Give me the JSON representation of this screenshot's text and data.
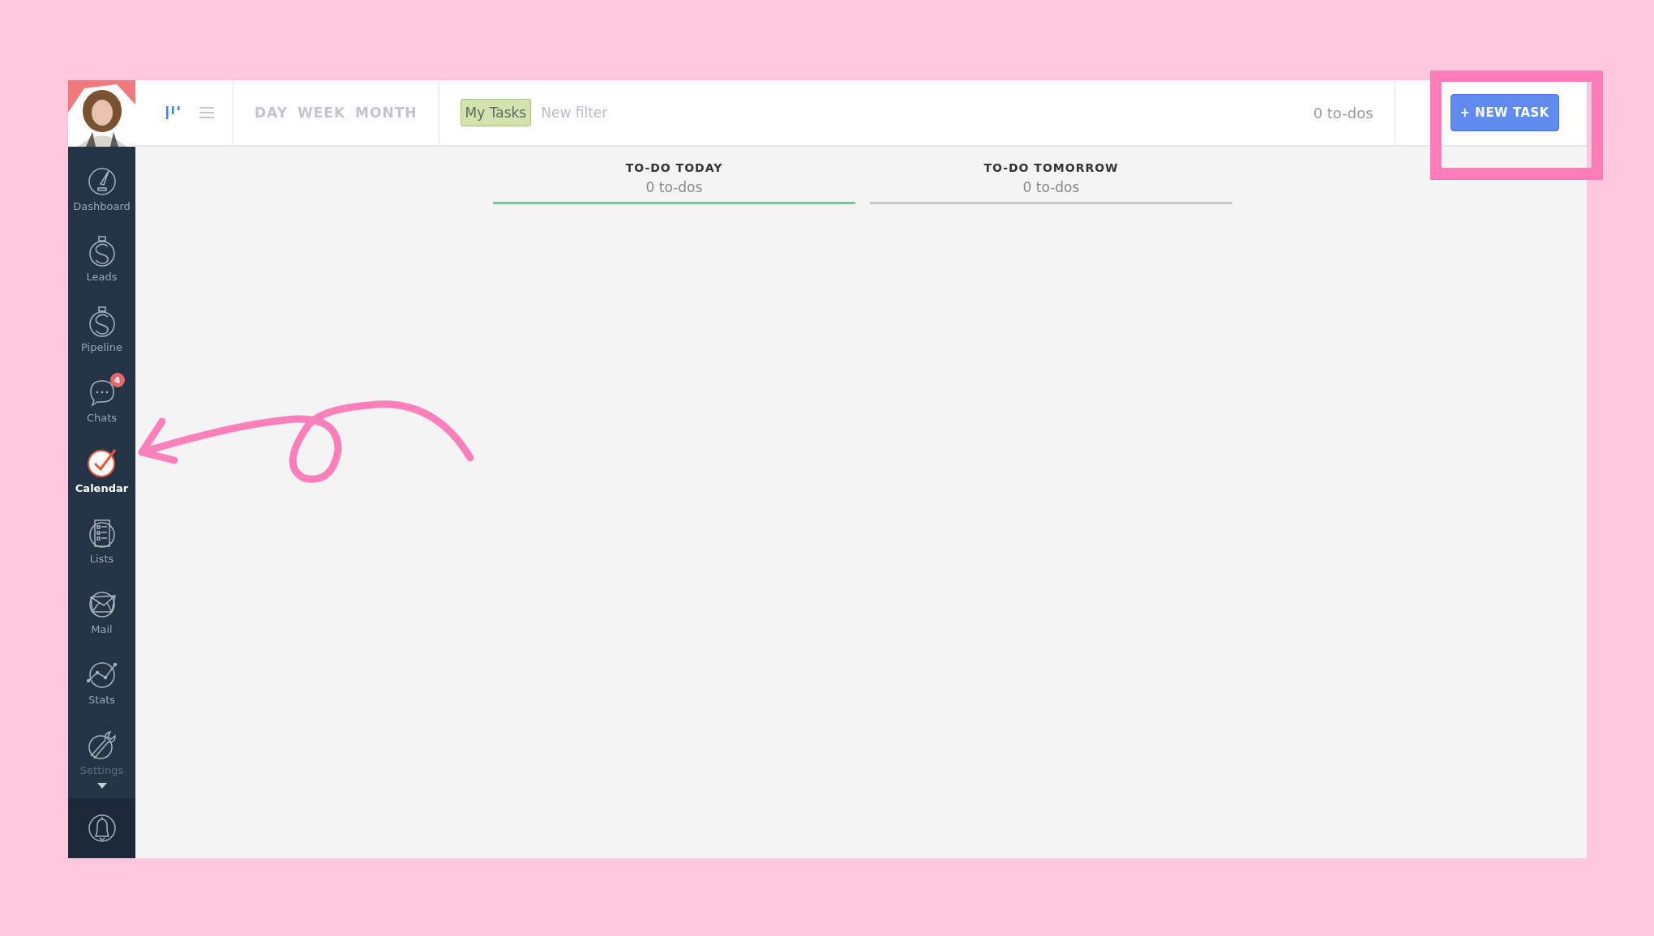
{
  "sidebar": {
    "items": [
      {
        "label": "Dashboard",
        "selected": false
      },
      {
        "label": "Leads",
        "selected": false
      },
      {
        "label": "Pipeline",
        "selected": false
      },
      {
        "label": "Chats",
        "selected": false,
        "badge": "4"
      },
      {
        "label": "Calendar",
        "selected": true
      },
      {
        "label": "Lists",
        "selected": false
      },
      {
        "label": "Mail",
        "selected": false
      },
      {
        "label": "Stats",
        "selected": false
      },
      {
        "label": "Settings",
        "selected": false
      }
    ]
  },
  "toolbar": {
    "views": [
      {
        "selected": true
      },
      {
        "selected": false
      }
    ],
    "ranges": [
      {
        "label": "DAY",
        "selected": false
      },
      {
        "label": "WEEK",
        "selected": false
      },
      {
        "label": "MONTH",
        "selected": false
      }
    ],
    "filters": [
      {
        "label": "My Tasks",
        "selected": true
      },
      {
        "label": "New filter",
        "selected": false
      }
    ],
    "count": "0 to-dos",
    "new_task": "+ NEW TASK"
  },
  "columns": [
    {
      "title": "TO-DO TODAY",
      "count": "0 to-dos",
      "selected": true
    },
    {
      "title": "TO-DO TOMORROW",
      "count": "0 to-dos",
      "selected": false
    }
  ]
}
